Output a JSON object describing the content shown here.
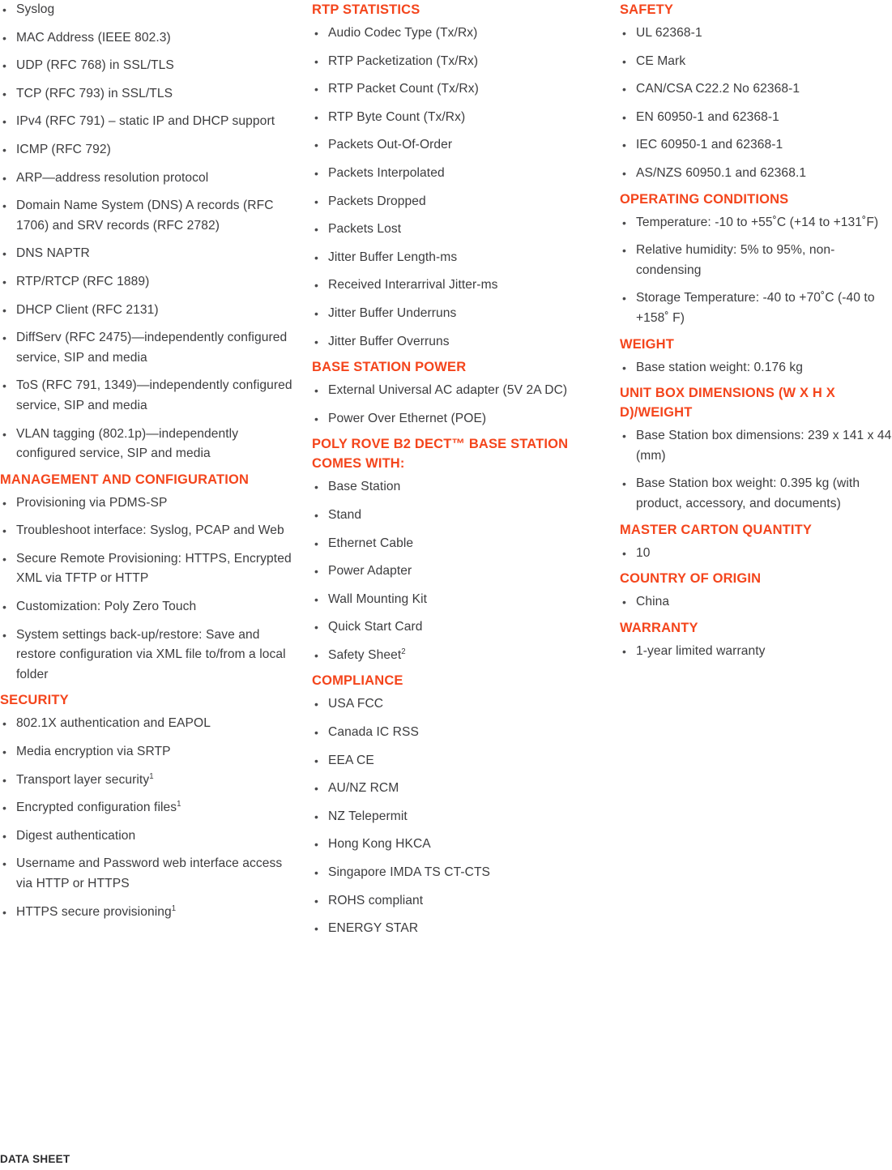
{
  "theme": {
    "heading_color": "#F4451C",
    "body_color": "#3C3C3E",
    "footer_color": "#2B2B2D",
    "background": "#FFFFFF"
  },
  "footer": {
    "label": "DATA SHEET"
  },
  "columns": [
    {
      "id": "column-1",
      "sections": [
        {
          "id": "protocols-continued",
          "heading": null,
          "items": [
            "Syslog",
            "MAC Address (IEEE 802.3)",
            "UDP (RFC 768) in SSL/TLS",
            "TCP (RFC 793) in SSL/TLS",
            "IPv4 (RFC 791) – static IP and DHCP support",
            "ICMP (RFC 792)",
            "ARP—address resolution protocol",
            "Domain Name System (DNS) A records (RFC 1706) and SRV records (RFC 2782)",
            "DNS NAPTR",
            "RTP/RTCP (RFC 1889)",
            "DHCP Client (RFC 2131)",
            "DiffServ (RFC 2475)—independently configured service, SIP and media",
            "ToS (RFC 791, 1349)—independently configured service, SIP and media",
            "VLAN tagging (802.1p)—independently configured service, SIP and media"
          ]
        },
        {
          "id": "management-and-configuration",
          "heading": "MANAGEMENT AND CONFIGURATION",
          "items": [
            "Provisioning via PDMS-SP",
            "Troubleshoot interface: Syslog, PCAP and Web",
            "Secure Remote Provisioning: HTTPS, Encrypted XML via TFTP or HTTP",
            "Customization: Poly Zero Touch",
            "System settings back-up/restore: Save and restore configuration via XML file to/from a local folder"
          ]
        },
        {
          "id": "security",
          "heading": "SECURITY",
          "items": [
            "802.1X authentication and EAPOL",
            "Media encryption via SRTP",
            "Transport layer security¹",
            "Encrypted configuration files¹",
            " Digest authentication",
            "Username and Password web interface access via HTTP or HTTPS",
            "HTTPS secure provisioning¹"
          ]
        }
      ]
    },
    {
      "id": "column-2",
      "sections": [
        {
          "id": "rtp-statistics",
          "heading": "RTP STATISTICS",
          "items": [
            "Audio Codec Type (Tx/Rx)",
            "RTP Packetization (Tx/Rx)",
            "RTP Packet Count (Tx/Rx)",
            "RTP Byte Count (Tx/Rx)",
            "Packets Out-Of-Order",
            "Packets Interpolated",
            "Packets Dropped",
            "Packets Lost",
            "Jitter Buffer Length-ms",
            "Received Interarrival Jitter-ms",
            "Jitter Buffer Underruns",
            "Jitter Buffer Overruns"
          ]
        },
        {
          "id": "base-station-power",
          "heading": "BASE STATION POWER",
          "items": [
            "External Universal AC adapter (5V 2A DC)",
            "Power Over Ethernet (POE)"
          ]
        },
        {
          "id": "comes-with",
          "heading": "POLY ROVE B2 DECT™ BASE STATION COMES WITH:",
          "items": [
            "Base Station",
            "Stand",
            "Ethernet Cable",
            "Power Adapter",
            "Wall Mounting Kit",
            "Quick Start Card",
            "Safety Sheet²"
          ]
        },
        {
          "id": "compliance",
          "heading": "COMPLIANCE",
          "items": [
            "USA FCC",
            "Canada IC RSS",
            "EEA CE",
            "AU/NZ RCM",
            "NZ Telepermit",
            "Hong Kong HKCA",
            "Singapore IMDA TS CT-CTS",
            "ROHS compliant",
            "ENERGY STAR"
          ]
        }
      ]
    },
    {
      "id": "column-3",
      "sections": [
        {
          "id": "safety",
          "heading": "SAFETY",
          "items": [
            "UL 62368-1",
            "CE Mark",
            "CAN/CSA C22.2 No 62368-1",
            "EN 60950-1 and 62368-1",
            "IEC 60950-1 and 62368-1",
            "AS/NZS 60950.1 and 62368.1"
          ]
        },
        {
          "id": "operating-conditions",
          "heading": "OPERATING CONDITIONS",
          "items": [
            "Temperature: -10 to +55˚C (+14 to +131˚F)",
            "Relative humidity: 5% to 95%, non-condensing",
            "Storage Temperature: -40 to +70˚C (-40 to +158˚ F)"
          ]
        },
        {
          "id": "weight",
          "heading": "WEIGHT",
          "items": [
            "Base station weight: 0.176 kg"
          ]
        },
        {
          "id": "unit-box-dimensions",
          "heading": "UNIT BOX DIMENSIONS (W X H X D)/WEIGHT",
          "items": [
            "Base Station box dimensions: 239 x 141 x 44 (mm)",
            "Base Station box weight: 0.395 kg (with product, accessory, and documents)"
          ]
        },
        {
          "id": "master-carton-quantity",
          "heading": "MASTER CARTON QUANTITY",
          "items": [
            "10"
          ]
        },
        {
          "id": "country-of-origin",
          "heading": "COUNTRY OF ORIGIN",
          "items": [
            "China"
          ]
        },
        {
          "id": "warranty",
          "heading": "WARRANTY",
          "items": [
            "1-year limited warranty"
          ]
        }
      ]
    }
  ]
}
